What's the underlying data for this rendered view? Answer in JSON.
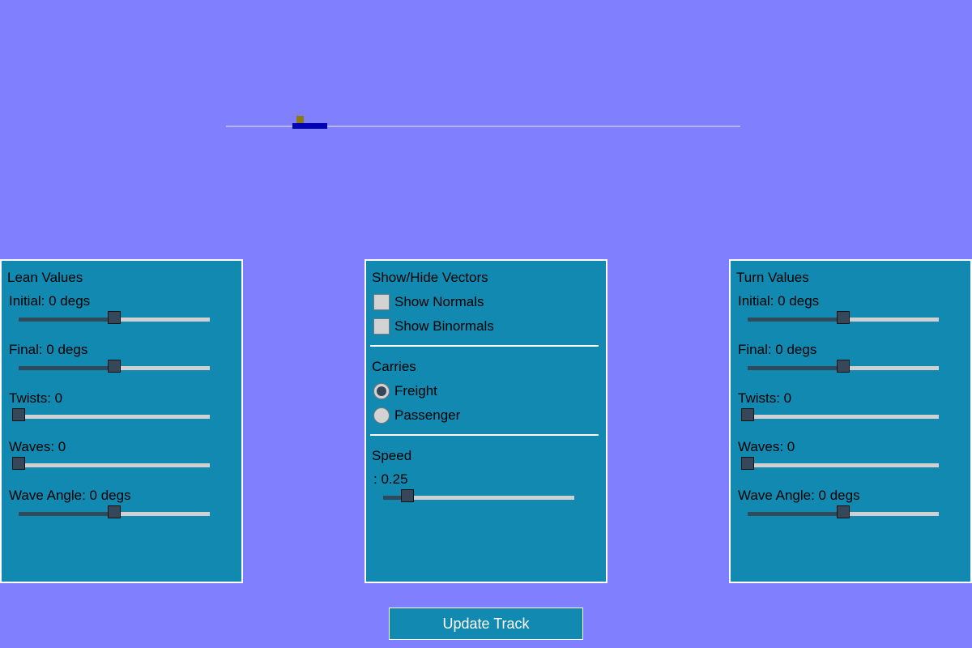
{
  "scene": {
    "background": "#8080ff",
    "track_color": "#c8c8e8",
    "car_color": "#0000b4",
    "cargo_color": "#8a7a10"
  },
  "lean_panel": {
    "title": "Lean Values",
    "sliders": [
      {
        "label": "Initial: 0 degs",
        "value_fraction": 0.5
      },
      {
        "label": "Final: 0 degs",
        "value_fraction": 0.5
      },
      {
        "label": "Twists: 0",
        "value_fraction": 0.0
      },
      {
        "label": "Waves: 0",
        "value_fraction": 0.0
      },
      {
        "label": "Wave Angle: 0 degs",
        "value_fraction": 0.5
      }
    ]
  },
  "vectors_panel": {
    "title": "Show/Hide Vectors",
    "checkboxes": [
      {
        "label": "Show Normals",
        "checked": false
      },
      {
        "label": "Show Binormals",
        "checked": false
      }
    ],
    "carries_title": "Carries",
    "radios": [
      {
        "label": "Freight",
        "checked": true
      },
      {
        "label": "Passenger",
        "checked": false
      }
    ],
    "speed_title": "Speed",
    "speed_slider": {
      "label": ": 0.25",
      "value_fraction": 0.125
    }
  },
  "turn_panel": {
    "title": "Turn Values",
    "sliders": [
      {
        "label": "Initial: 0 degs",
        "value_fraction": 0.5
      },
      {
        "label": "Final: 0 degs",
        "value_fraction": 0.5
      },
      {
        "label": "Twists: 0",
        "value_fraction": 0.0
      },
      {
        "label": "Waves: 0",
        "value_fraction": 0.0
      },
      {
        "label": "Wave Angle: 0 degs",
        "value_fraction": 0.5
      }
    ]
  },
  "update_button": {
    "label": "Update Track"
  }
}
